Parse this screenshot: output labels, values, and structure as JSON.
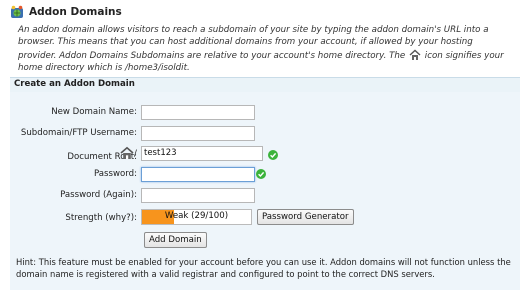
{
  "header": {
    "title": "Addon Domains",
    "description_before_icon": "An addon domain allows visitors to reach a subdomain of your site by typing the addon domain's URL into a browser. This means that you can host additional domains from your account, if allowed by your hosting provider. Addon Domains Subdomains are relative to your account's home directory. The ",
    "description_after_icon": " icon signifies your home directory which is /home3/isoldit."
  },
  "section": {
    "title": "Create an Addon Domain"
  },
  "form": {
    "new_domain_label": "New Domain Name:",
    "new_domain_value": "",
    "subdomain_label": "Subdomain/FTP Username:",
    "subdomain_value": "",
    "docroot_label": "Document Root:",
    "docroot_slash": "/",
    "docroot_value": "test123",
    "password_label": "Password:",
    "password_value": "",
    "password_again_label": "Password (Again):",
    "password_again_value": "",
    "strength_label": "Strength (why?):",
    "strength_text": "Weak (29/100)",
    "strength_score": 29,
    "password_generator_label": "Password Generator",
    "add_domain_label": "Add Domain"
  },
  "hint": "Hint: This feature must be enabled for your account before you can use it. Addon domains will not function unless the domain name is registered with a valid registrar and configured to point to the correct DNS servers.",
  "colors": {
    "strength_fill": "#f7941d",
    "check": "#3bb33b",
    "panel": "#eef5fa"
  },
  "icons": [
    "addon-domains-icon",
    "home-directory-icon",
    "check-icon"
  ]
}
